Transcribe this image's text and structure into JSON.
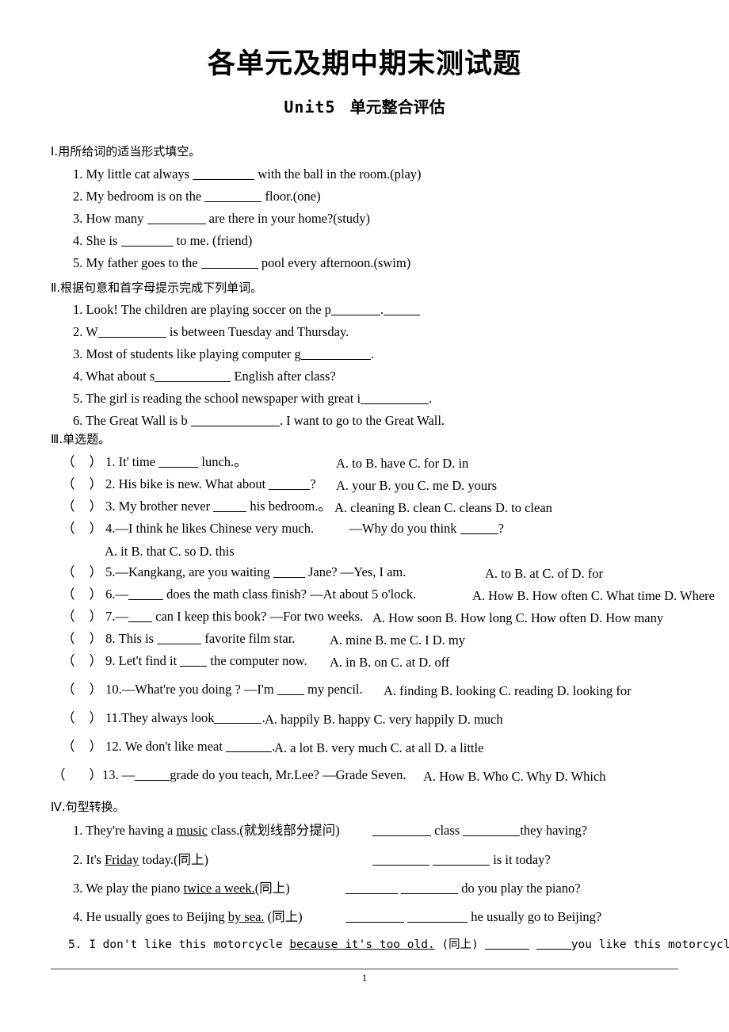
{
  "document": {
    "title": "各单元及期中期末测试题",
    "subtitle_unit": "Unit5",
    "subtitle_cn": "单元整合评估",
    "page_number": "1"
  },
  "section1": {
    "heading": "Ⅰ.用所给词的适当形式填空。",
    "items": [
      {
        "pre": "1. My little cat always",
        "post": "with the ball in the room.(play)"
      },
      {
        "pre": "2. My bedroom is on the",
        "post": "floor.(one)"
      },
      {
        "pre": "3. How many",
        "post": "are there in your home?(study)"
      },
      {
        "pre": "4. She is",
        "post": "to me. (friend)"
      },
      {
        "pre": "5. My father goes to the",
        "post": "pool every afternoon.(swim)"
      }
    ]
  },
  "section2": {
    "heading": "Ⅱ.根据句意和首字母提示完成下列单词。",
    "items": [
      {
        "pre": "1. Look! The children are playing soccer on the p",
        "post": "."
      },
      {
        "pre": "2. W",
        "post": "is between Tuesday and Thursday."
      },
      {
        "pre": "3. Most of students like playing computer g",
        "post": "."
      },
      {
        "pre": "4. What about s",
        "post": "English after class?"
      },
      {
        "pre": "5. The girl is reading the school newspaper with great i",
        "post": "."
      },
      {
        "pre": "6. The Great Wall is b",
        "post": ". I want to go to the Great Wall."
      }
    ]
  },
  "section3": {
    "heading": "Ⅲ.单选题。",
    "bracket_open": "（",
    "bracket_close": "）",
    "items": [
      {
        "num": "1.",
        "stem_pre": "It' time",
        "stem_post": "lunch.。",
        "options": "A. to        B. have        C. for      D. in"
      },
      {
        "num": "2.",
        "stem_pre": "His bike is new. What about",
        "stem_post": "?",
        "options": "A. your     B. you    C. me     D. yours"
      },
      {
        "num": "3.",
        "stem_pre": "My brother never",
        "stem_post": "his bedroom.。",
        "options": "A. cleaning     B. clean      C. cleans    D. to clean"
      },
      {
        "num": "4.",
        "stem_pre": "—I think he likes Chinese very much.",
        "stem_mid": "—Why do you think",
        "stem_post": "?",
        "options": "A. it                 B. that            C. so           D. this"
      },
      {
        "num": "5.",
        "stem_pre": "—Kangkang, are you waiting",
        "stem_post": "Jane?   —Yes, I am.",
        "options": "A. to   B. at   C. of    D. for"
      },
      {
        "num": "6.",
        "stem_pre": "—",
        "stem_post": "does the math class finish?    —At about 5 o'lock.",
        "options": "A. How    B. How often    C. What time    D. Where"
      },
      {
        "num": "7.",
        "stem_pre": "—",
        "stem_post": "can I keep this book? —For two weeks.",
        "options": "A. How soon     B. How long    C. How often    D. How many"
      },
      {
        "num": "8.",
        "stem_pre": "This is",
        "stem_post": "favorite film star.",
        "options": "A. mine      B. me      C. I       D. my"
      },
      {
        "num": "9.",
        "stem_pre": "Let't find it",
        "stem_post": "the computer now.",
        "options": "A. in        B. on       C. at          D. off"
      },
      {
        "num": "10.",
        "stem_pre": "—What're you doing ?   —I'm",
        "stem_post": "my pencil.",
        "options": "A. finding   B. looking     C. reading   D. looking for"
      },
      {
        "num": "11.",
        "stem_pre": "They always look",
        "stem_post": ".",
        "options": "A. happily      B. happy    C. very happily      D. much"
      },
      {
        "num": "12.",
        "stem_pre": "We don't like meat",
        "stem_post": ".",
        "options": "A. a lot        B. very much      C. at all    D. a little"
      },
      {
        "num": "13.",
        "stem_pre": "—",
        "stem_post": "grade do you teach, Mr.Lee? —Grade Seven.",
        "options": "A. How       B. Who      C. Why      D. Which"
      }
    ]
  },
  "section4": {
    "heading": "Ⅳ.句型转换。",
    "items": [
      {
        "q_a": "1. They're having a ",
        "q_u": "music",
        "q_b": " class.(就划线部分提问)",
        "a_mid": "class",
        "a_end": "they having?"
      },
      {
        "q_a": "2. It's ",
        "q_u": "Friday",
        "q_b": " today.(同上)",
        "a_mid": "",
        "a_end": "is it today?"
      },
      {
        "q_a": "3. We play the piano ",
        "q_u": "twice a week.",
        "q_b": "(同上)",
        "a_mid": "",
        "a_end": "do you play the piano?"
      },
      {
        "q_a": "4. He usually goes to Beijing ",
        "q_u": "by sea.",
        "q_b": " (同上)",
        "a_mid": "",
        "a_end": "he usually go to Beijing?"
      },
      {
        "q_a": "5.  I don't like this motorcycle ",
        "q_u": "because it's too old.",
        "q_b": " (同上)",
        "a_mid": "",
        "a_end": "you like this motorcycle?"
      }
    ]
  }
}
